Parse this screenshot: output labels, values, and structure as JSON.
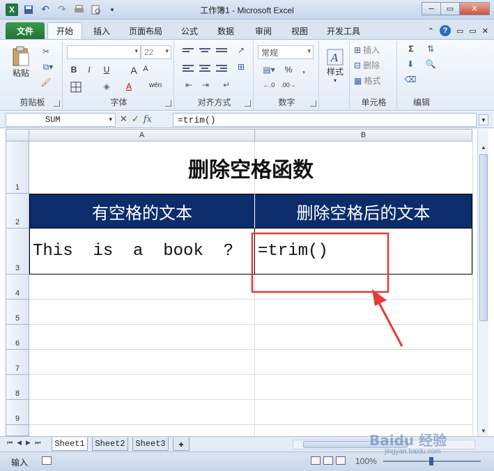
{
  "window": {
    "title": "工作簿1 - Microsoft Excel",
    "minimize": "─",
    "maximize": "▭",
    "close": "✕"
  },
  "ribbon_tabs": [
    "文件",
    "开始",
    "插入",
    "页面布局",
    "公式",
    "数据",
    "审阅",
    "视图",
    "开发工具"
  ],
  "ribbon": {
    "clipboard": {
      "label": "剪贴板",
      "paste": "粘贴"
    },
    "font": {
      "label": "字体",
      "font_name": "",
      "font_size": "22",
      "bold": "B",
      "italic": "I",
      "underline": "U",
      "grow": "A",
      "shrink": "A",
      "color": "A",
      "phonetic": "wén"
    },
    "alignment": {
      "label": "对齐方式"
    },
    "number": {
      "label": "数字",
      "format": "常规",
      "percent": "%",
      "comma": ","
    },
    "styles": {
      "label": "样式",
      "button": "样式"
    },
    "cells": {
      "label": "单元格",
      "insert": "插入",
      "delete": "删除",
      "format": "格式"
    },
    "editing": {
      "label": "编辑",
      "sum": "Σ"
    }
  },
  "formula_bar": {
    "name_box": "SUM",
    "fx": "fx",
    "formula": "=trim()"
  },
  "columns": [
    "A",
    "B"
  ],
  "rows": [
    "1",
    "2",
    "3",
    "4",
    "5",
    "6",
    "7",
    "8",
    "9"
  ],
  "sheet": {
    "title": "删除空格函数",
    "header_a": "有空格的文本",
    "header_b": "删除空格后的文本",
    "a3": "This  is  a  book  ?",
    "b3": "=trim()"
  },
  "sheet_tabs": [
    "Sheet1",
    "Sheet2",
    "Sheet3"
  ],
  "status": {
    "mode": "输入",
    "zoom": "100%"
  },
  "watermark": {
    "brand": "Baidu 经验",
    "url": "jingyan.baidu.com"
  },
  "colors": {
    "header_fill": "#0d2c6b",
    "annotation": "#e53935",
    "file_tab": "#1f7334"
  }
}
